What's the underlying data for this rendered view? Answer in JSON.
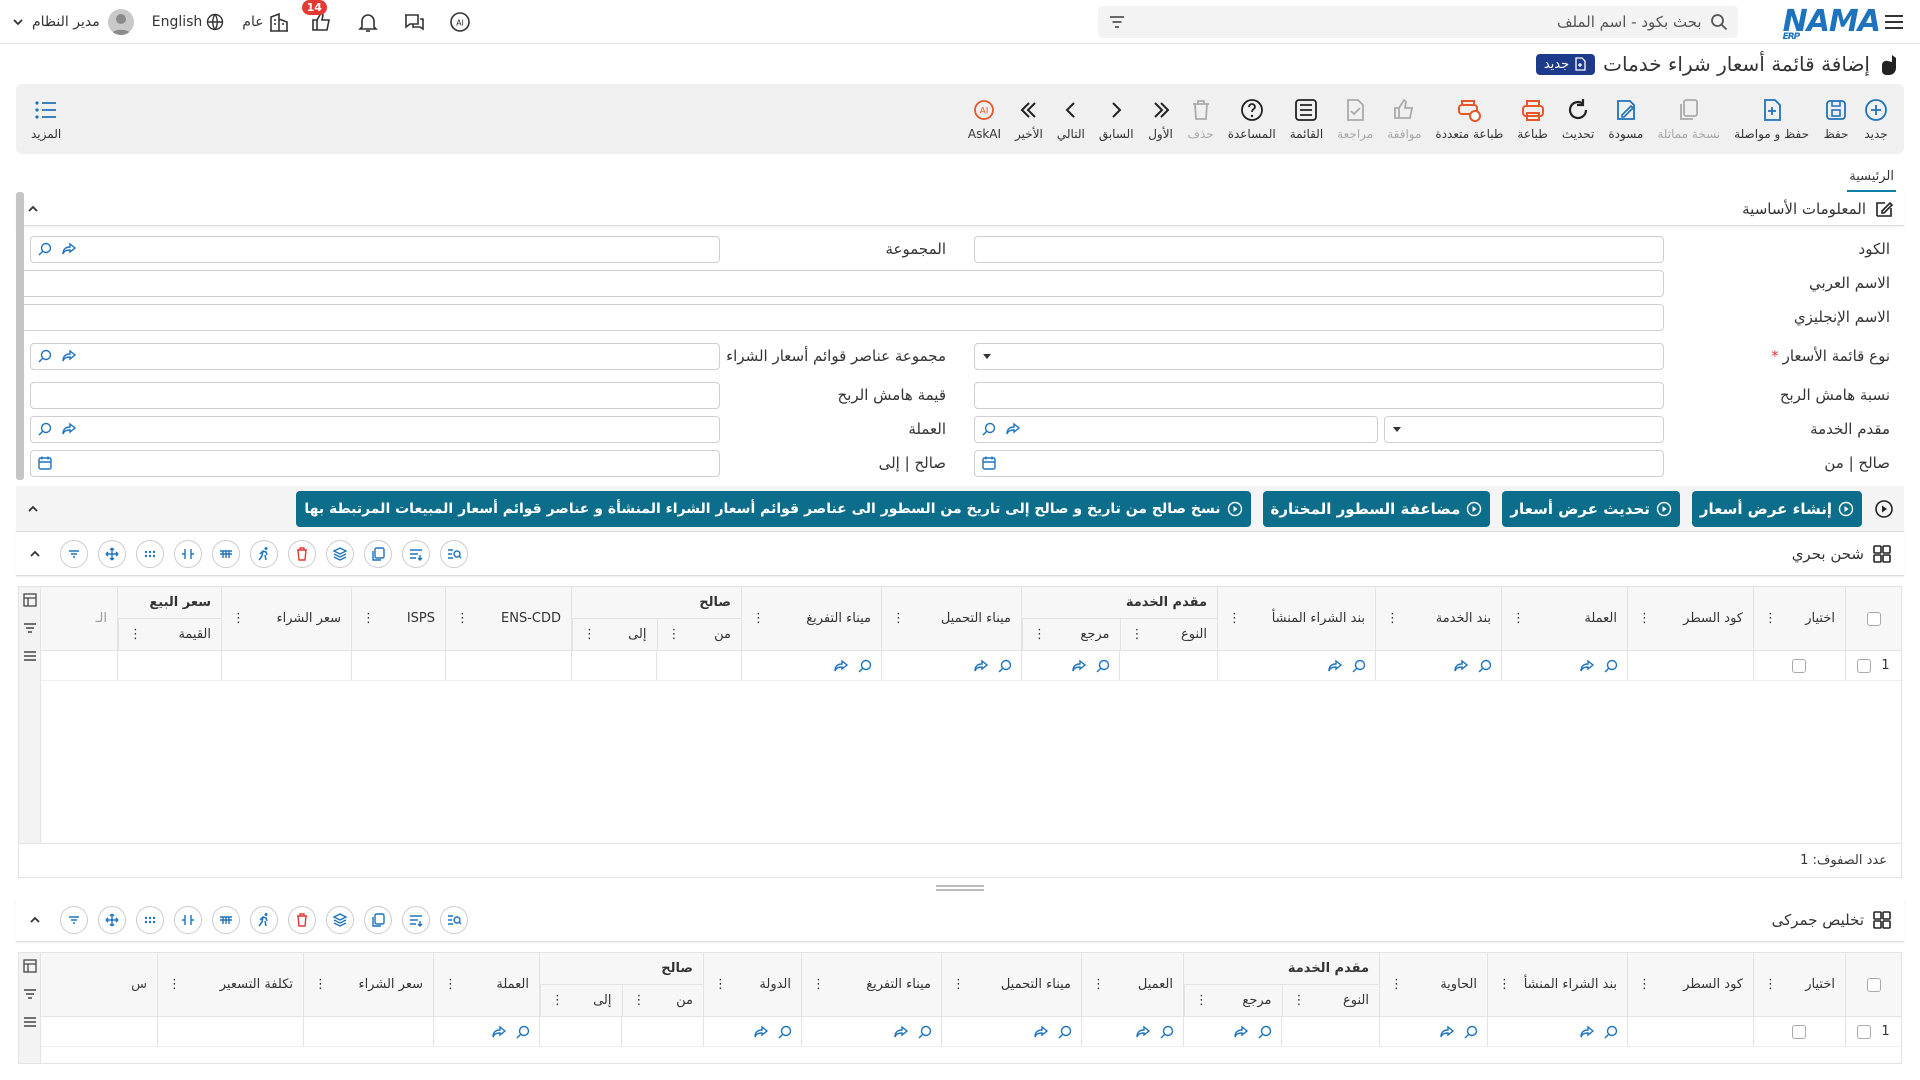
{
  "topbar": {
    "logo_text": "NAMA",
    "logo_sub": "ERP",
    "search_placeholder": "بحث بكود - اسم الملف",
    "notification_count": "14",
    "general_label": "عام",
    "language": "English",
    "user_name": "مدير النظام"
  },
  "page": {
    "title": "إضافة قائمة أسعار شراء خدمات",
    "new_badge": "جديد"
  },
  "toolbar": {
    "items": [
      {
        "label": "جديد",
        "icon": "plus-circle-icon",
        "enabled": true
      },
      {
        "label": "حفظ",
        "icon": "save-icon",
        "enabled": true
      },
      {
        "label": "حفظ و مواصلة",
        "icon": "save-continue-icon",
        "enabled": true
      },
      {
        "label": "نسخة مماثلة",
        "icon": "duplicate-icon",
        "enabled": false
      },
      {
        "label": "مسودة",
        "icon": "draft-icon",
        "enabled": true
      },
      {
        "label": "تحديث",
        "icon": "refresh-icon",
        "enabled": true
      },
      {
        "label": "طباعة",
        "icon": "print-icon",
        "enabled": true
      },
      {
        "label": "طباعة متعددة",
        "icon": "multi-print-icon",
        "enabled": true
      },
      {
        "label": "موافقة",
        "icon": "approve-icon",
        "enabled": false
      },
      {
        "label": "مراجعة",
        "icon": "review-icon",
        "enabled": false
      },
      {
        "label": "القائمة",
        "icon": "list-icon",
        "enabled": true
      },
      {
        "label": "المساعدة",
        "icon": "help-icon",
        "enabled": true
      },
      {
        "label": "حذف",
        "icon": "delete-icon",
        "enabled": false
      },
      {
        "label": "الأول",
        "icon": "first-icon",
        "enabled": true
      },
      {
        "label": "السابق",
        "icon": "previous-icon",
        "enabled": true
      },
      {
        "label": "التالي",
        "icon": "next-icon",
        "enabled": true
      },
      {
        "label": "الأخير",
        "icon": "last-icon",
        "enabled": true
      },
      {
        "label": "AskAI",
        "icon": "ask-ai-icon",
        "enabled": true
      }
    ],
    "more_label": "المزيد"
  },
  "tabs": {
    "main": "الرئيسية"
  },
  "basic_info": {
    "title": "المعلومات الأساسية",
    "code": "الكود",
    "group": "المجموعة",
    "arabic_name": "الاسم العربي",
    "english_name": "الاسم الإنجليزي",
    "price_list_type": "نوع قائمة الأسعار",
    "purchase_items_group": "مجموعة عناصر قوائم أسعار الشراء",
    "profit_margin_pct": "نسبة هامش الربح",
    "profit_margin_value": "قيمة هامش الربح",
    "service_provider": "مقدم الخدمة",
    "currency": "العملة",
    "valid_from": "صالح | من",
    "valid_to": "صالح | إلى"
  },
  "actions": {
    "create_quote": "إنشاء عرض أسعار",
    "update_quote": "تحديث عرض أسعار",
    "duplicate_lines": "مضاعفة السطور المختارة",
    "copy_validity": "نسخ صالح من تاريخ و صالح إلى تاريخ من السطور الى عناصر قوائم أسعار الشراء المنشأة و عناصر قوائم أسعار المبيعات المرتبطة بها"
  },
  "sea_grid": {
    "title": "شحن بحري",
    "cols": {
      "select": "اختيار",
      "line_code": "كود السطر",
      "currency": "العملة",
      "service_item": "بند الخدمة",
      "origin_purchase_item": "بند الشراء المنشأ",
      "service_provider": "مقدم الخدمة",
      "type": "النوع",
      "ref": "مرجع",
      "loading_port": "ميناء التحميل",
      "discharge_port": "ميناء التفريغ",
      "valid": "صالح",
      "from": "من",
      "to": "إلى",
      "ens_cdd": "ENS-CDD",
      "isps": "ISPS",
      "purchase_price": "سعر الشراء",
      "sale_price": "سعر البيع",
      "value": "القيمة",
      "cut": "الـ"
    },
    "row_number": "1",
    "rows_count": "عدد الصفوف: 1"
  },
  "customs_grid": {
    "title": "تخليص جمركى",
    "cols": {
      "select": "اختيار",
      "line_code": "كود السطر",
      "origin_purchase_item": "بند الشراء المنشأ",
      "container": "الحاوية",
      "service_provider": "مقدم الخدمة",
      "type": "النوع",
      "ref": "مرجع",
      "customer": "العميل",
      "loading_port": "ميناء التحميل",
      "discharge_port": "ميناء التفريغ",
      "country": "الدولة",
      "valid": "صالح",
      "from": "من",
      "to": "إلى",
      "currency": "العملة",
      "purchase_price": "سعر الشراء",
      "pricing_cost": "تكلفة التسعير",
      "cut": "س"
    },
    "row_number": "1"
  }
}
